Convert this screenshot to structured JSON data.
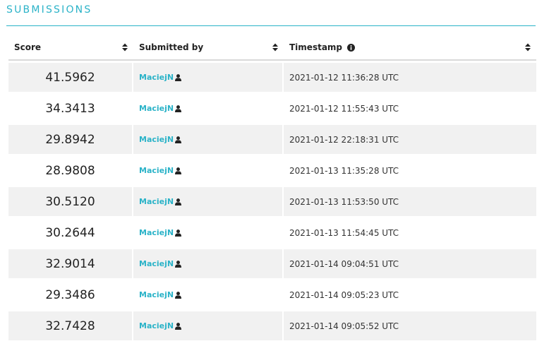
{
  "section": {
    "title": "SUBMISSIONS"
  },
  "table": {
    "columns": {
      "score": "Score",
      "submitted_by": "Submitted by",
      "timestamp": "Timestamp"
    },
    "rows": [
      {
        "score": "41.5962",
        "user": "MaciejN",
        "timestamp": "2021-01-12 11:36:28 UTC"
      },
      {
        "score": "34.3413",
        "user": "MaciejN",
        "timestamp": "2021-01-12 11:55:43 UTC"
      },
      {
        "score": "29.8942",
        "user": "MaciejN",
        "timestamp": "2021-01-12 22:18:31 UTC"
      },
      {
        "score": "28.9808",
        "user": "MaciejN",
        "timestamp": "2021-01-13 11:35:28 UTC"
      },
      {
        "score": "30.5120",
        "user": "MaciejN",
        "timestamp": "2021-01-13 11:53:50 UTC"
      },
      {
        "score": "30.2644",
        "user": "MaciejN",
        "timestamp": "2021-01-13 11:54:45 UTC"
      },
      {
        "score": "32.9014",
        "user": "MaciejN",
        "timestamp": "2021-01-14 09:04:51 UTC"
      },
      {
        "score": "29.3486",
        "user": "MaciejN",
        "timestamp": "2021-01-14 09:05:23 UTC"
      },
      {
        "score": "32.7428",
        "user": "MaciejN",
        "timestamp": "2021-01-14 09:05:52 UTC"
      }
    ]
  },
  "icons": {
    "sort": "sort-icon",
    "info": "info-icon",
    "user": "user-icon"
  },
  "colors": {
    "accent": "#2bb3c8",
    "row_stripe": "#f1f1f1"
  }
}
